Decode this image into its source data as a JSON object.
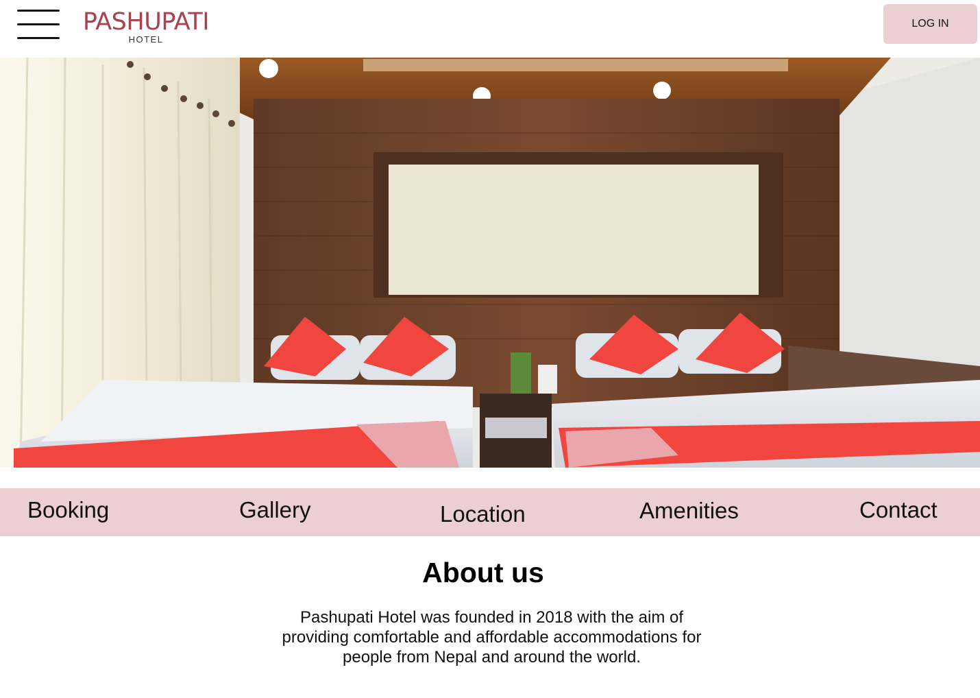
{
  "header": {
    "menu_icon": "hamburger-menu-icon",
    "logo_main": "PASHUPATI",
    "logo_sub": "HOTEL",
    "login_label": "LOG IN"
  },
  "hero": {
    "image": "hotel-room-photo"
  },
  "nav": {
    "items": [
      "Booking",
      "Gallery",
      "Location",
      "Amenities",
      "Contact"
    ]
  },
  "about": {
    "title": "About us",
    "text": "Pashupati Hotel was founded in 2018 with the aim of providing comfortable and affordable accommodations for people from Nepal and around the world."
  },
  "colors": {
    "accent_pink": "#ebcfd2",
    "logo_red": "#a8424f",
    "pillow_red": "#f0463f"
  }
}
